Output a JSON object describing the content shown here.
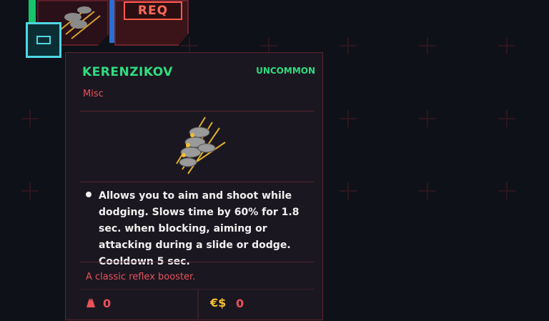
{
  "top_cards": {
    "req_label": "REQ"
  },
  "tooltip": {
    "title": "KERENZIKOV",
    "rarity": "UNCOMMON",
    "type": "Misc",
    "description": "Allows you to aim and shoot while dodging. Slows time by 60% for 1.8 sec. when blocking, aiming or attacking during a slide or dodge. Cooldown 5 sec.",
    "flavor": "A classic reflex booster.",
    "weight": "0",
    "price_icon": "€$",
    "price": "0"
  },
  "colors": {
    "rarity_green": "#2fdc7f",
    "accent_red": "#e8525a",
    "slot_cyan": "#4fd7e6",
    "money_yellow": "#f2c230"
  }
}
